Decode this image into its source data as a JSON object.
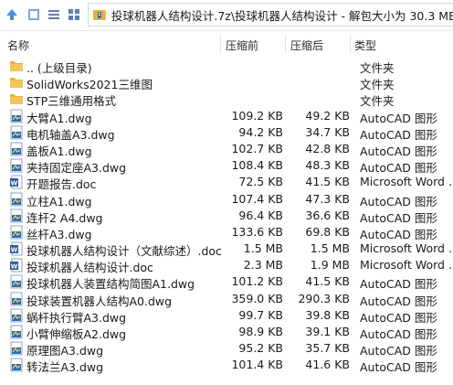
{
  "toolbar": {
    "path": "投球机器人结构设计.7z\\投球机器人结构设计 - 解包大小为 30.3 MB"
  },
  "columns": {
    "name": "名称",
    "size": "压缩前",
    "packed": "压缩后",
    "type": "类型"
  },
  "colors": {
    "folder": "#e8b23c",
    "dwg": "#2d6db5",
    "doc": "#2b5797"
  },
  "rows": [
    {
      "icon": "folder",
      "name": ".. (上级目录)",
      "size": "",
      "packed": "",
      "type": "文件夹"
    },
    {
      "icon": "folder",
      "name": "SolidWorks2021三维图",
      "size": "",
      "packed": "",
      "type": "文件夹"
    },
    {
      "icon": "folder",
      "name": "STP三维通用格式",
      "size": "",
      "packed": "",
      "type": "文件夹"
    },
    {
      "icon": "dwg",
      "name": "大臂A1.dwg",
      "size": "109.2 KB",
      "packed": "49.2 KB",
      "type": "AutoCAD 图形"
    },
    {
      "icon": "dwg",
      "name": "电机轴盖A3.dwg",
      "size": "94.2 KB",
      "packed": "34.7 KB",
      "type": "AutoCAD 图形"
    },
    {
      "icon": "dwg",
      "name": "盖板A1.dwg",
      "size": "102.7 KB",
      "packed": "42.8 KB",
      "type": "AutoCAD 图形"
    },
    {
      "icon": "dwg",
      "name": "夹持固定座A3.dwg",
      "size": "108.4 KB",
      "packed": "48.3 KB",
      "type": "AutoCAD 图形"
    },
    {
      "icon": "doc",
      "name": "开题报告.doc",
      "size": "72.5 KB",
      "packed": "41.5 KB",
      "type": "Microsoft Word ..."
    },
    {
      "icon": "dwg",
      "name": "立柱A1.dwg",
      "size": "107.4 KB",
      "packed": "47.3 KB",
      "type": "AutoCAD 图形"
    },
    {
      "icon": "dwg",
      "name": "连杆2 A4.dwg",
      "size": "96.4 KB",
      "packed": "36.6 KB",
      "type": "AutoCAD 图形"
    },
    {
      "icon": "dwg",
      "name": "丝杆A3.dwg",
      "size": "133.6 KB",
      "packed": "69.8 KB",
      "type": "AutoCAD 图形"
    },
    {
      "icon": "doc",
      "name": "投球机器人结构设计（文献综述）.doc",
      "size": "1.5 MB",
      "packed": "1.5 MB",
      "type": "Microsoft Word ..."
    },
    {
      "icon": "doc",
      "name": "投球机器人结构设计.doc",
      "size": "2.3 MB",
      "packed": "1.9 MB",
      "type": "Microsoft Word ..."
    },
    {
      "icon": "dwg",
      "name": "投球机器人装置结构简图A1.dwg",
      "size": "101.2 KB",
      "packed": "41.5 KB",
      "type": "AutoCAD 图形"
    },
    {
      "icon": "dwg",
      "name": "投球装置机器人结构A0.dwg",
      "size": "359.0 KB",
      "packed": "290.3 KB",
      "type": "AutoCAD 图形"
    },
    {
      "icon": "dwg",
      "name": "蜗杆执行臂A3.dwg",
      "size": "99.7 KB",
      "packed": "39.8 KB",
      "type": "AutoCAD 图形"
    },
    {
      "icon": "dwg",
      "name": "小臂伸缩板A2.dwg",
      "size": "98.9 KB",
      "packed": "39.1 KB",
      "type": "AutoCAD 图形"
    },
    {
      "icon": "dwg",
      "name": "原理图A3.dwg",
      "size": "95.2 KB",
      "packed": "35.7 KB",
      "type": "AutoCAD 图形"
    },
    {
      "icon": "dwg",
      "name": "转法兰A3.dwg",
      "size": "101.4 KB",
      "packed": "41.6 KB",
      "type": "AutoCAD 图形"
    }
  ]
}
